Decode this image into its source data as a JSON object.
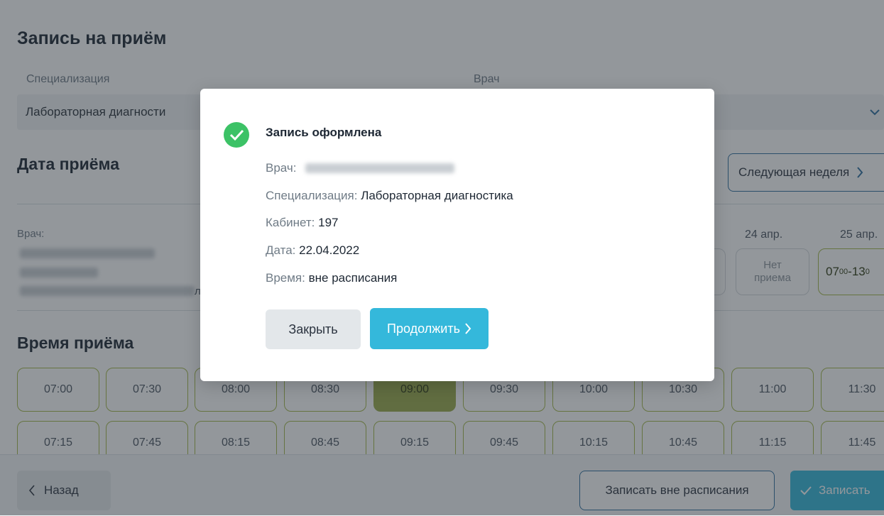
{
  "header": {
    "title": "Запись на приём"
  },
  "form": {
    "specialization_label": "Специализация",
    "specialization_value": "Лабораторная диагности",
    "doctor_label": "Врач"
  },
  "date_section": {
    "title": "Дата приёма",
    "next_week_label": "Следующая неделя",
    "doctor_label": "Врач:",
    "doctor_tail_char": "л",
    "days": [
      {
        "label": "24 апр.",
        "schedule": "Нет приема"
      },
      {
        "label": "25 апр.",
        "schedule_html_hint": "07-13"
      }
    ],
    "no_reception_line1": "Нет",
    "no_reception_line2": "приема",
    "time_range_start": "07",
    "time_range_start_sup": "00",
    "time_range_end": "13",
    "time_range_end_sup": "0"
  },
  "time_section": {
    "title": "Время приёма",
    "row1": [
      "07:00",
      "07:30",
      "08:00",
      "08:30",
      "09:00",
      "09:30",
      "10:00",
      "10:30",
      "11:00",
      "11:30"
    ],
    "row2": [
      "07:15",
      "07:45",
      "08:15",
      "08:45",
      "09:15",
      "09:45",
      "10:15",
      "10:45",
      "11:15",
      "11:45"
    ],
    "selected": "09:00"
  },
  "footer": {
    "back_label": "Назад",
    "unscheduled_label": "Записать вне расписания",
    "submit_label": "Записать"
  },
  "modal": {
    "title": "Запись оформлена",
    "doctor_label": "Врач:",
    "specialization_label": "Специализация:",
    "specialization_value": "Лабораторная диагностика",
    "cabinet_label": "Кабинет:",
    "cabinet_value": "197",
    "date_label": "Дата:",
    "date_value": "22.04.2022",
    "time_label": "Время:",
    "time_value": "вне расписания",
    "close_label": "Закрыть",
    "continue_label": "Продолжить"
  },
  "colors": {
    "accent": "#34b8db",
    "success": "#3cc266",
    "slot_border": "#a4b84a",
    "slot_selected": "#9aab4a"
  },
  "icons": [
    "check-circle-icon",
    "chevron-right-icon",
    "chevron-left-icon",
    "chevron-down-icon",
    "check-icon"
  ]
}
